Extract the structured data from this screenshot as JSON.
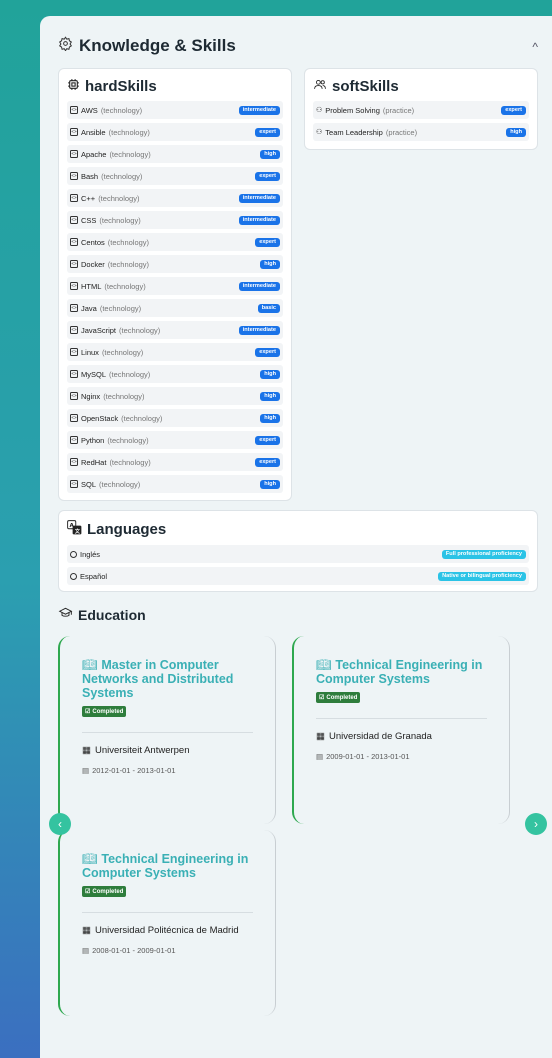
{
  "knowledge": {
    "title": "Knowledge & Skills",
    "collapse_glyph": "^"
  },
  "hardSkills": {
    "title": "hardSkills",
    "items": [
      {
        "name": "AWS",
        "category": "(technology)",
        "level": "intermediate"
      },
      {
        "name": "Ansible",
        "category": "(technology)",
        "level": "expert"
      },
      {
        "name": "Apache",
        "category": "(technology)",
        "level": "high"
      },
      {
        "name": "Bash",
        "category": "(technology)",
        "level": "expert"
      },
      {
        "name": "C++",
        "category": "(technology)",
        "level": "intermediate"
      },
      {
        "name": "CSS",
        "category": "(technology)",
        "level": "intermediate"
      },
      {
        "name": "Centos",
        "category": "(technology)",
        "level": "expert"
      },
      {
        "name": "Docker",
        "category": "(technology)",
        "level": "high"
      },
      {
        "name": "HTML",
        "category": "(technology)",
        "level": "intermediate"
      },
      {
        "name": "Java",
        "category": "(technology)",
        "level": "basic"
      },
      {
        "name": "JavaScript",
        "category": "(technology)",
        "level": "intermediate"
      },
      {
        "name": "Linux",
        "category": "(technology)",
        "level": "expert"
      },
      {
        "name": "MySQL",
        "category": "(technology)",
        "level": "high"
      },
      {
        "name": "Nginx",
        "category": "(technology)",
        "level": "high"
      },
      {
        "name": "OpenStack",
        "category": "(technology)",
        "level": "high"
      },
      {
        "name": "Python",
        "category": "(technology)",
        "level": "expert"
      },
      {
        "name": "RedHat",
        "category": "(technology)",
        "level": "expert"
      },
      {
        "name": "SQL",
        "category": "(technology)",
        "level": "high"
      }
    ]
  },
  "softSkills": {
    "title": "softSkills",
    "items": [
      {
        "name": "Problem Solving",
        "category": "(practice)",
        "level": "expert"
      },
      {
        "name": "Team Leadership",
        "category": "(practice)",
        "level": "high"
      }
    ]
  },
  "languages": {
    "title": "Languages",
    "items": [
      {
        "name": "Inglés",
        "level": "Full professional proficiency"
      },
      {
        "name": "Español",
        "level": "Native or bilingual proficiency"
      }
    ]
  },
  "education": {
    "title": "Education",
    "items": [
      {
        "degree": "Master in Computer Networks and Distributed Systems",
        "status": "Completed",
        "institution": "Universiteit Antwerpen",
        "dates": "2012-01-01 - 2013-01-01"
      },
      {
        "degree": "Technical Engineering in Computer Systems",
        "status": "Completed",
        "institution": "Universidad de Granada",
        "dates": "2009-01-01 - 2013-01-01"
      },
      {
        "degree": "Technical Engineering in Computer Systems",
        "status": "Completed",
        "institution": "Universidad Politécnica de Madrid",
        "dates": "2008-01-01 - 2009-01-01"
      }
    ]
  },
  "colors": {
    "accent": "#3ab0b5",
    "badge_blue": "#1a73e8",
    "badge_cyan": "#2bc3e6",
    "completed_green": "#2e7d3c"
  }
}
